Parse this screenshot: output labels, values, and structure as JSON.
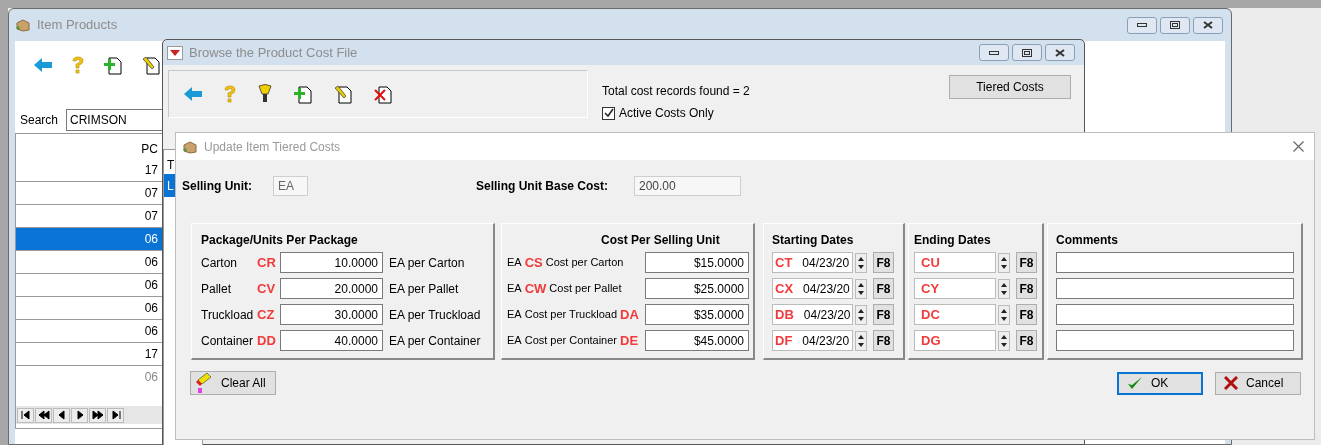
{
  "item_products_window": {
    "title": "Item Products",
    "search_label": "Search",
    "search_value": "CRIMSON",
    "table": {
      "column_header": "PC",
      "rows": [
        {
          "value": "17",
          "selected": false,
          "dimmed": false
        },
        {
          "value": "07",
          "selected": false,
          "dimmed": false
        },
        {
          "value": "07",
          "selected": false,
          "dimmed": false
        },
        {
          "value": "06",
          "selected": true,
          "dimmed": false
        },
        {
          "value": "06",
          "selected": false,
          "dimmed": false
        },
        {
          "value": "06",
          "selected": false,
          "dimmed": false
        },
        {
          "value": "06",
          "selected": false,
          "dimmed": false
        },
        {
          "value": "06",
          "selected": false,
          "dimmed": false
        },
        {
          "value": "17",
          "selected": false,
          "dimmed": false
        },
        {
          "value": "06",
          "selected": false,
          "dimmed": true
        }
      ]
    }
  },
  "browse_window": {
    "title": "Browse the Product Cost File",
    "record_count": "Total cost records found = 2",
    "active_costs_only": {
      "label": "Active Costs Only",
      "checked": true
    },
    "tiered_costs_button": "Tiered Costs",
    "table": {
      "column_header": "T",
      "rows": [
        {
          "value": "L",
          "selected": true
        }
      ]
    }
  },
  "dialog": {
    "title": "Update Item Tiered Costs",
    "selling_unit": {
      "label": "Selling Unit:",
      "value": "EA"
    },
    "base_cost": {
      "label": "Selling Unit Base Cost:",
      "value": "200.00"
    },
    "package_group": {
      "title": "Package/Units Per Package",
      "rows": [
        {
          "label": "Carton",
          "code": "CR",
          "value": "10.0000",
          "unit": "EA per Carton"
        },
        {
          "label": "Pallet",
          "code": "CV",
          "value": "20.0000",
          "unit": "EA per Pallet"
        },
        {
          "label": "Truckload",
          "code": "CZ",
          "value": "30.0000",
          "unit": "EA per Truckload"
        },
        {
          "label": "Container",
          "code": "DD",
          "value": "40.0000",
          "unit": "EA per Container"
        }
      ]
    },
    "cost_group": {
      "title": "Cost Per Selling Unit",
      "rows": [
        {
          "unit": "EA",
          "code": "CS",
          "label": "Cost per Carton",
          "value": "$15.0000",
          "kind": "prefixed"
        },
        {
          "unit": "EA",
          "code": "CW",
          "label": "Cost per Pallet",
          "value": "$25.0000",
          "kind": "prefixed"
        },
        {
          "unit": "EA",
          "code": "DA",
          "label": "Cost per Truckload",
          "value": "$35.0000",
          "kind": "suffixed"
        },
        {
          "unit": "EA",
          "code": "DE",
          "label": "Cost per Container",
          "value": "$45.0000",
          "kind": "suffixed"
        }
      ]
    },
    "starting_dates": {
      "title": "Starting Dates",
      "rows": [
        {
          "code": "CT",
          "date": "04/23/20",
          "button": "F8"
        },
        {
          "code": "CX",
          "date": "04/23/20",
          "button": "F8"
        },
        {
          "code": "DB",
          "date": "04/23/20",
          "button": "F8"
        },
        {
          "code": "DF",
          "date": "04/23/20",
          "button": "F8"
        }
      ]
    },
    "ending_dates": {
      "title": "Ending Dates",
      "rows": [
        {
          "code": "CU",
          "button": "F8"
        },
        {
          "code": "CY",
          "button": "F8"
        },
        {
          "code": "DC",
          "button": "F8"
        },
        {
          "code": "DG",
          "button": "F8"
        }
      ]
    },
    "comments": {
      "title": "Comments",
      "rows": [
        {
          "kind": "text-field"
        },
        {
          "kind": "text-field"
        },
        {
          "kind": "text-field"
        },
        {
          "kind": "text-field"
        }
      ]
    },
    "clear_button": "Clear All",
    "ok_button": {
      "label": "OK",
      "default": true
    },
    "cancel_button": "Cancel"
  }
}
